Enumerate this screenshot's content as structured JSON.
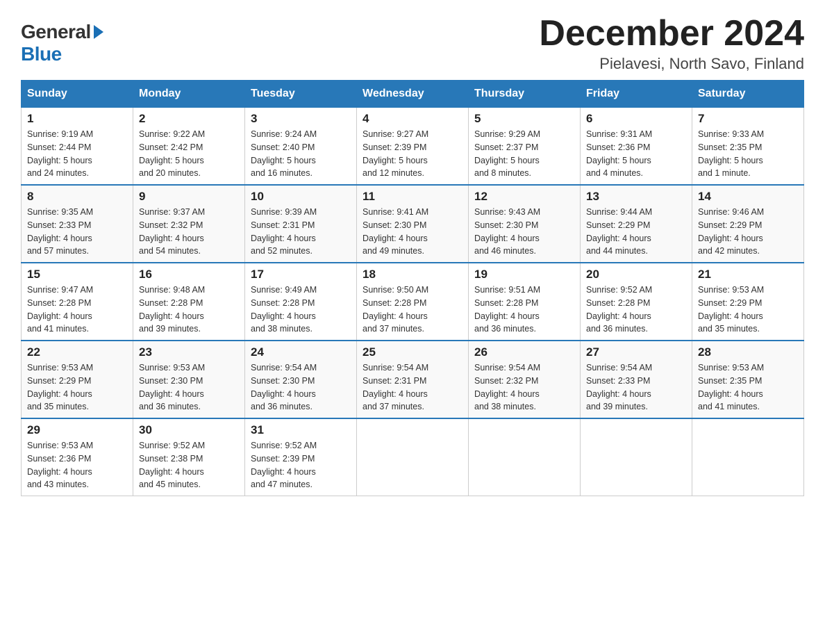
{
  "logo": {
    "general": "General",
    "blue": "Blue"
  },
  "title": "December 2024",
  "location": "Pielavesi, North Savo, Finland",
  "days_of_week": [
    "Sunday",
    "Monday",
    "Tuesday",
    "Wednesday",
    "Thursday",
    "Friday",
    "Saturday"
  ],
  "weeks": [
    [
      {
        "day": "1",
        "sunrise": "9:19 AM",
        "sunset": "2:44 PM",
        "daylight": "5 hours and 24 minutes."
      },
      {
        "day": "2",
        "sunrise": "9:22 AM",
        "sunset": "2:42 PM",
        "daylight": "5 hours and 20 minutes."
      },
      {
        "day": "3",
        "sunrise": "9:24 AM",
        "sunset": "2:40 PM",
        "daylight": "5 hours and 16 minutes."
      },
      {
        "day": "4",
        "sunrise": "9:27 AM",
        "sunset": "2:39 PM",
        "daylight": "5 hours and 12 minutes."
      },
      {
        "day": "5",
        "sunrise": "9:29 AM",
        "sunset": "2:37 PM",
        "daylight": "5 hours and 8 minutes."
      },
      {
        "day": "6",
        "sunrise": "9:31 AM",
        "sunset": "2:36 PM",
        "daylight": "5 hours and 4 minutes."
      },
      {
        "day": "7",
        "sunrise": "9:33 AM",
        "sunset": "2:35 PM",
        "daylight": "5 hours and 1 minute."
      }
    ],
    [
      {
        "day": "8",
        "sunrise": "9:35 AM",
        "sunset": "2:33 PM",
        "daylight": "4 hours and 57 minutes."
      },
      {
        "day": "9",
        "sunrise": "9:37 AM",
        "sunset": "2:32 PM",
        "daylight": "4 hours and 54 minutes."
      },
      {
        "day": "10",
        "sunrise": "9:39 AM",
        "sunset": "2:31 PM",
        "daylight": "4 hours and 52 minutes."
      },
      {
        "day": "11",
        "sunrise": "9:41 AM",
        "sunset": "2:30 PM",
        "daylight": "4 hours and 49 minutes."
      },
      {
        "day": "12",
        "sunrise": "9:43 AM",
        "sunset": "2:30 PM",
        "daylight": "4 hours and 46 minutes."
      },
      {
        "day": "13",
        "sunrise": "9:44 AM",
        "sunset": "2:29 PM",
        "daylight": "4 hours and 44 minutes."
      },
      {
        "day": "14",
        "sunrise": "9:46 AM",
        "sunset": "2:29 PM",
        "daylight": "4 hours and 42 minutes."
      }
    ],
    [
      {
        "day": "15",
        "sunrise": "9:47 AM",
        "sunset": "2:28 PM",
        "daylight": "4 hours and 41 minutes."
      },
      {
        "day": "16",
        "sunrise": "9:48 AM",
        "sunset": "2:28 PM",
        "daylight": "4 hours and 39 minutes."
      },
      {
        "day": "17",
        "sunrise": "9:49 AM",
        "sunset": "2:28 PM",
        "daylight": "4 hours and 38 minutes."
      },
      {
        "day": "18",
        "sunrise": "9:50 AM",
        "sunset": "2:28 PM",
        "daylight": "4 hours and 37 minutes."
      },
      {
        "day": "19",
        "sunrise": "9:51 AM",
        "sunset": "2:28 PM",
        "daylight": "4 hours and 36 minutes."
      },
      {
        "day": "20",
        "sunrise": "9:52 AM",
        "sunset": "2:28 PM",
        "daylight": "4 hours and 36 minutes."
      },
      {
        "day": "21",
        "sunrise": "9:53 AM",
        "sunset": "2:29 PM",
        "daylight": "4 hours and 35 minutes."
      }
    ],
    [
      {
        "day": "22",
        "sunrise": "9:53 AM",
        "sunset": "2:29 PM",
        "daylight": "4 hours and 35 minutes."
      },
      {
        "day": "23",
        "sunrise": "9:53 AM",
        "sunset": "2:30 PM",
        "daylight": "4 hours and 36 minutes."
      },
      {
        "day": "24",
        "sunrise": "9:54 AM",
        "sunset": "2:30 PM",
        "daylight": "4 hours and 36 minutes."
      },
      {
        "day": "25",
        "sunrise": "9:54 AM",
        "sunset": "2:31 PM",
        "daylight": "4 hours and 37 minutes."
      },
      {
        "day": "26",
        "sunrise": "9:54 AM",
        "sunset": "2:32 PM",
        "daylight": "4 hours and 38 minutes."
      },
      {
        "day": "27",
        "sunrise": "9:54 AM",
        "sunset": "2:33 PM",
        "daylight": "4 hours and 39 minutes."
      },
      {
        "day": "28",
        "sunrise": "9:53 AM",
        "sunset": "2:35 PM",
        "daylight": "4 hours and 41 minutes."
      }
    ],
    [
      {
        "day": "29",
        "sunrise": "9:53 AM",
        "sunset": "2:36 PM",
        "daylight": "4 hours and 43 minutes."
      },
      {
        "day": "30",
        "sunrise": "9:52 AM",
        "sunset": "2:38 PM",
        "daylight": "4 hours and 45 minutes."
      },
      {
        "day": "31",
        "sunrise": "9:52 AM",
        "sunset": "2:39 PM",
        "daylight": "4 hours and 47 minutes."
      },
      null,
      null,
      null,
      null
    ]
  ],
  "labels": {
    "sunrise": "Sunrise:",
    "sunset": "Sunset:",
    "daylight": "Daylight:"
  }
}
